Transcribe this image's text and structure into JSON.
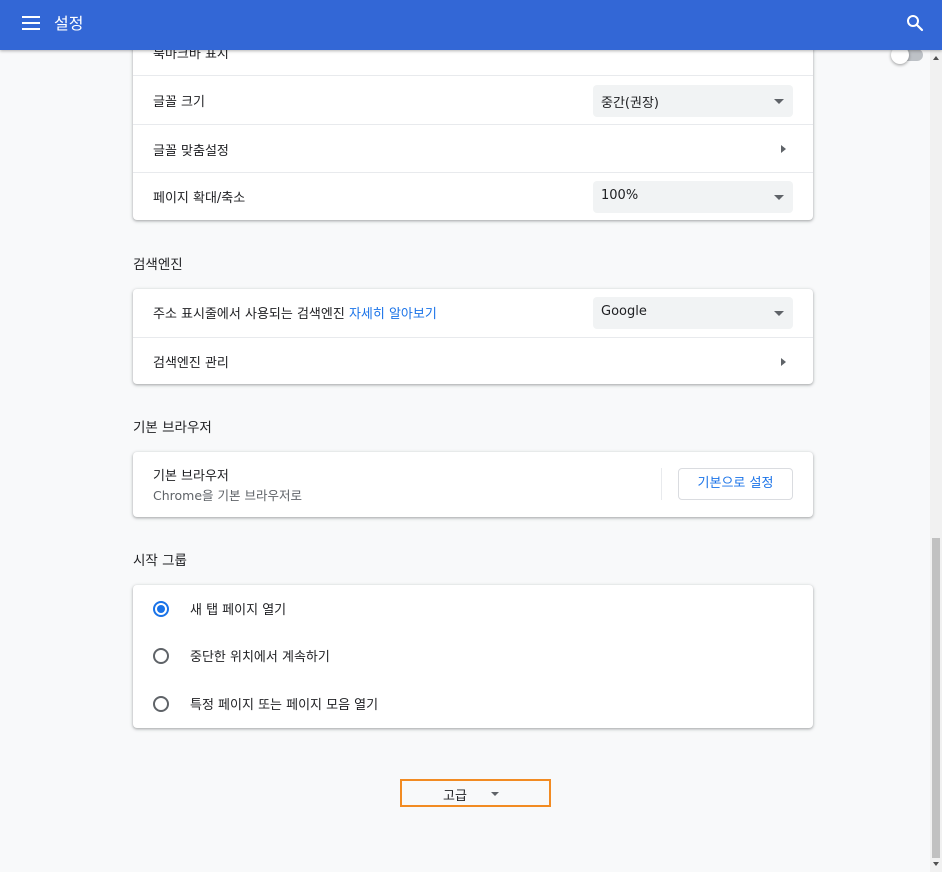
{
  "header": {
    "title": "설정",
    "menu_icon": "hamburger-menu-icon",
    "search_icon": "search-icon"
  },
  "appearance": {
    "partial_label": "북마크바 표시",
    "font_size": {
      "label": "글꼴 크기",
      "value": "중간(권장)"
    },
    "customize_fonts": {
      "label": "글꼴 맞춤설정"
    },
    "page_zoom": {
      "label": "페이지 확대/축소",
      "value": "100%"
    }
  },
  "search_engine": {
    "title": "검색엔진",
    "address_bar": {
      "label": "주소 표시줄에서 사용되는 검색엔진",
      "link": "자세히 알아보기",
      "value": "Google"
    },
    "manage": {
      "label": "검색엔진 관리"
    }
  },
  "default_browser": {
    "title": "기본 브라우저",
    "label": "기본 브라우저",
    "sublabel": "Chrome을 기본 브라우저로",
    "button": "기본으로 설정"
  },
  "on_startup": {
    "title": "시작 그룹",
    "options": [
      {
        "label": "새 탭 페이지 열기",
        "checked": true
      },
      {
        "label": "중단한 위치에서 계속하기",
        "checked": false
      },
      {
        "label": "특정 페이지 또는 페이지 모음 열기",
        "checked": false
      }
    ]
  },
  "advanced": {
    "label": "고급"
  },
  "colors": {
    "header": "#3367d6",
    "accent": "#1a73e8",
    "highlight": "#f28b22"
  }
}
